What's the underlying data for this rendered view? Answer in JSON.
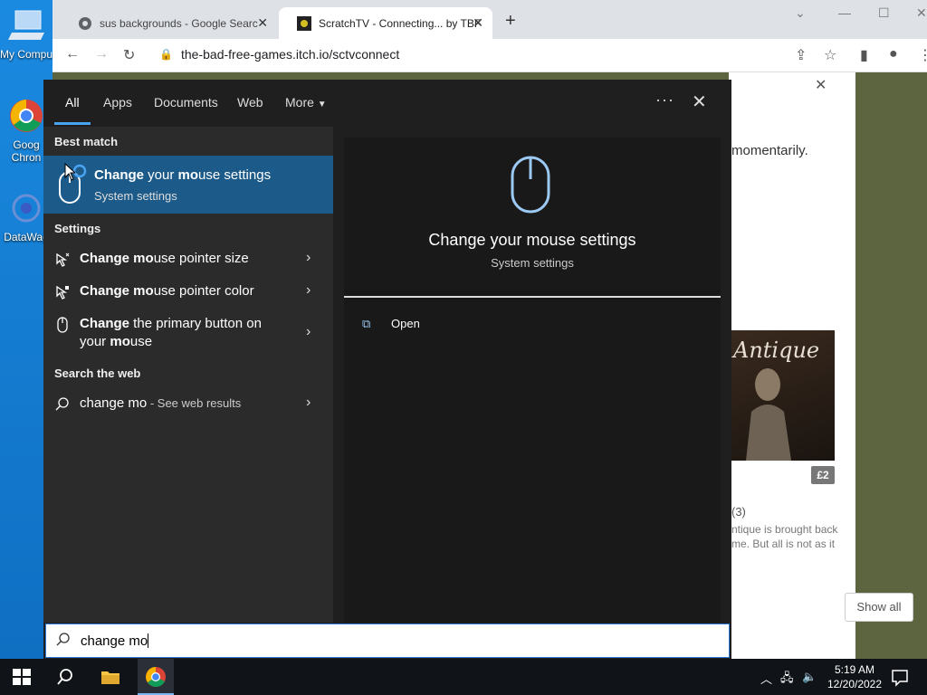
{
  "desktop": {
    "icons": [
      {
        "name": "My Computer",
        "label": "My Compu"
      },
      {
        "name": "Google Chrome",
        "label": "Goog\nChron"
      },
      {
        "name": "DataWag",
        "label": "DataWag"
      }
    ]
  },
  "browser": {
    "tabs": [
      {
        "title": "sus backgrounds - Google Searc",
        "active": false
      },
      {
        "title": "ScratchTV - Connecting... by TBF",
        "active": true
      }
    ],
    "url": "the-bad-free-games.itch.io/sctvconnect"
  },
  "page": {
    "partial_text_1": "momentarily.",
    "card_title": "Antique",
    "price": "£2",
    "rating_count": "(3)",
    "desc_1": "ntique is brought back",
    "desc_2": "me. But all is not as it",
    "show_all": "Show all"
  },
  "start_menu": {
    "tabs": [
      "All",
      "Apps",
      "Documents",
      "Web",
      "More"
    ],
    "active_tab": "All",
    "best_match_header": "Best match",
    "best_match": {
      "title_bold": "Change",
      "title_mid": " your ",
      "title_bold2": "mo",
      "title_rest": "use settings",
      "subtitle": "System settings"
    },
    "settings_header": "Settings",
    "settings_items": [
      {
        "bold": "Change mo",
        "rest": "use pointer size"
      },
      {
        "bold": "Change mo",
        "rest": "use pointer color"
      },
      {
        "bold": "Change",
        "rest": " the primary button on",
        "line2_pre": "your ",
        "line2_bold": "mo",
        "line2_rest": "use"
      }
    ],
    "web_header": "Search the web",
    "web_item": {
      "query": "change mo",
      "suffix": " - See web results"
    },
    "preview": {
      "title": "Change your mouse settings",
      "subtitle": "System settings",
      "action": "Open"
    }
  },
  "search": {
    "value": "change mo"
  },
  "taskbar": {
    "time": "5:19 AM",
    "date": "12/20/2022"
  }
}
